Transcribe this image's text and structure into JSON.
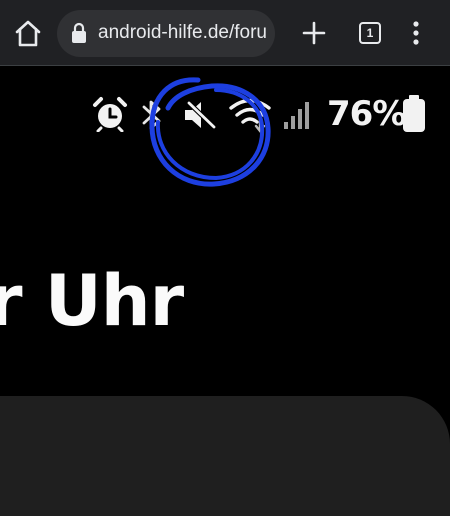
{
  "browser": {
    "url_display": "android-hilfe.de/foru",
    "tab_count": "1",
    "icons": {
      "home": "home-icon",
      "lock": "lock-icon",
      "new_tab": "plus-icon",
      "tabs": "tab-switcher-icon",
      "menu": "more-vert-icon"
    }
  },
  "content": {
    "status_bar": {
      "icons": [
        "alarm-icon",
        "bluetooth-icon",
        "mute-icon",
        "wifi-icon",
        "signal-icon",
        "battery-icon"
      ],
      "battery_percent": "76%"
    },
    "heading_text": "r Uhr",
    "annotation_color": "#1d3fe0"
  },
  "colors": {
    "toolbar_bg": "#202124",
    "omnibox_bg": "#303134",
    "toolbar_fg": "#e8eaed",
    "page_bg": "#000000",
    "card_bg": "#1f1f1f"
  }
}
